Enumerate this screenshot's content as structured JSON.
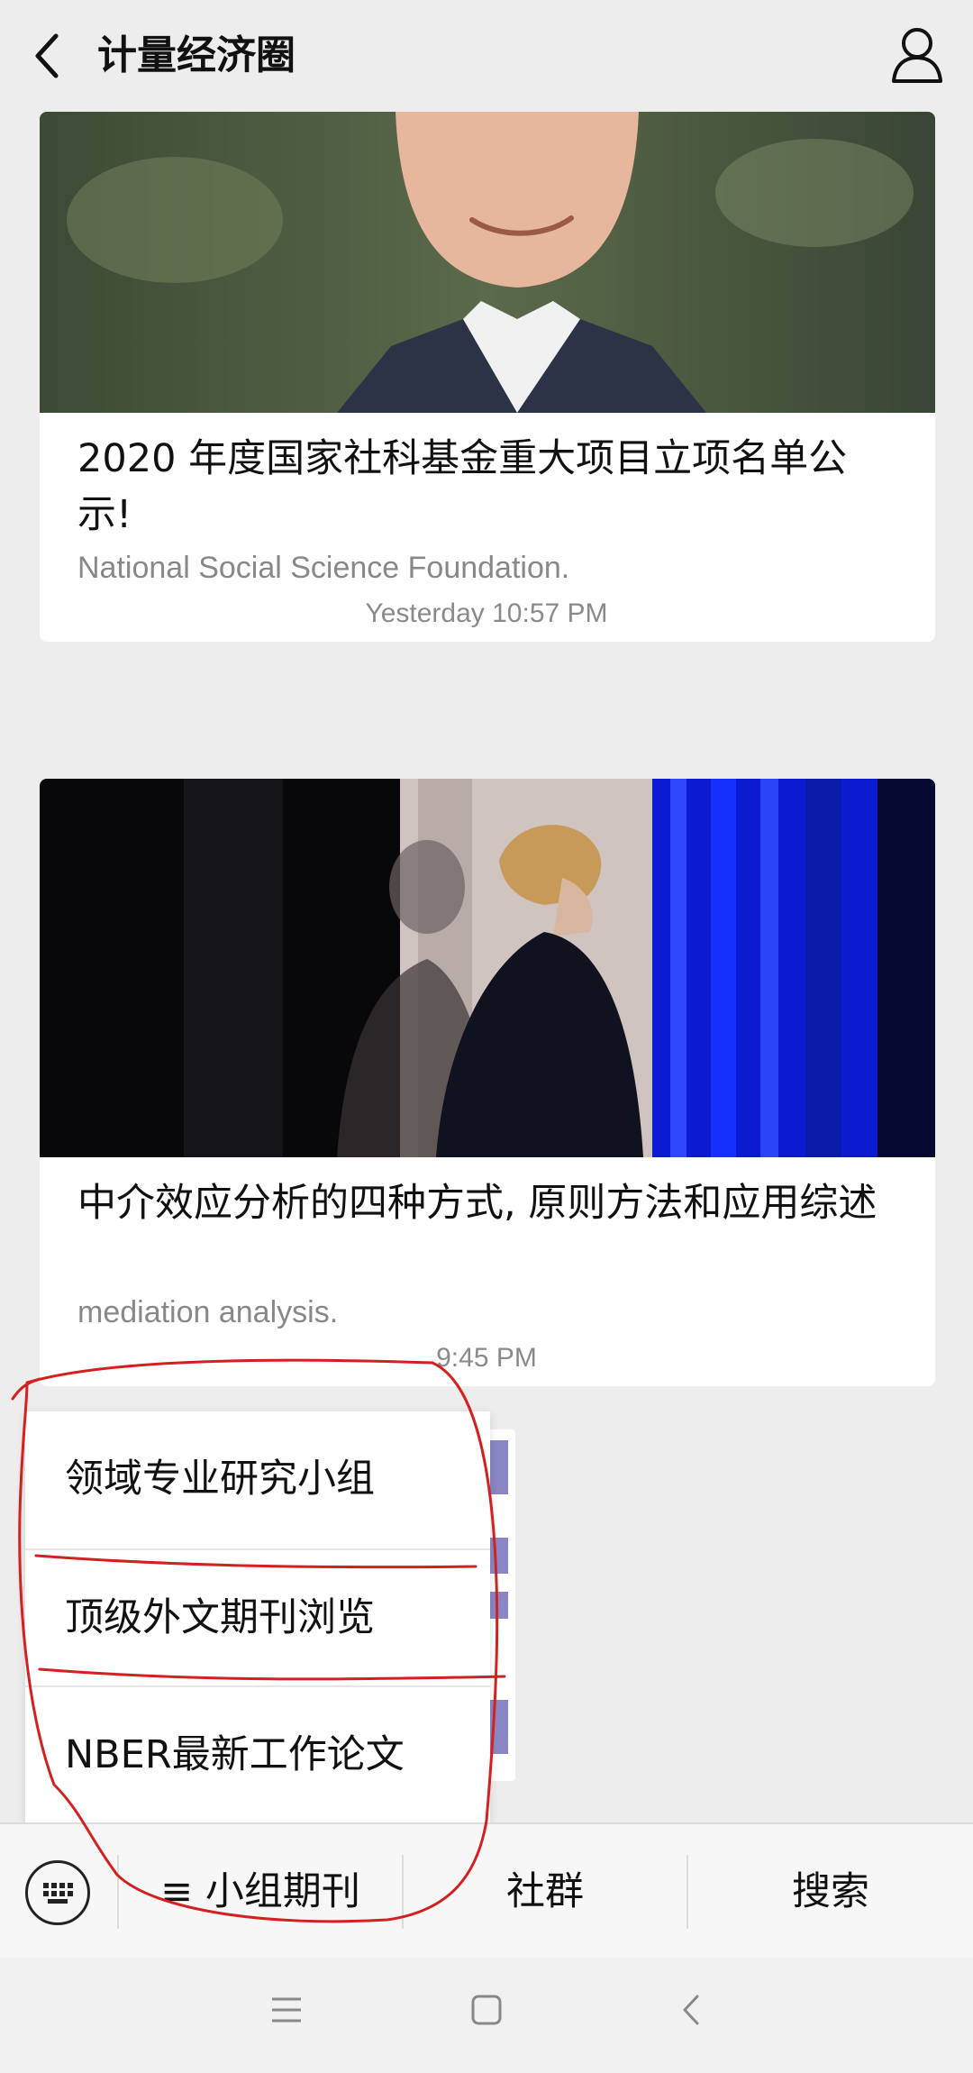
{
  "header": {
    "title": "计量经济圈"
  },
  "articles": [
    {
      "title": "2020 年度国家社科基金重大项目立项名单公示!",
      "subtitle": "National Social Science Foundation."
    },
    {
      "title": "中介效应分析的四种方式, 原则方法和应用综述",
      "subtitle": "mediation analysis."
    }
  ],
  "timestamps": [
    "Yesterday 10:57 PM",
    "9:45 PM"
  ],
  "popup_menu": {
    "items": [
      "领域专业研究小组",
      "顶级外文期刊浏览",
      "NBER最新工作论文"
    ]
  },
  "menubar": {
    "tab1": "≡ 小组期刊",
    "tab2": "社群",
    "tab3": "搜索"
  },
  "annotation_color": "#d42020"
}
